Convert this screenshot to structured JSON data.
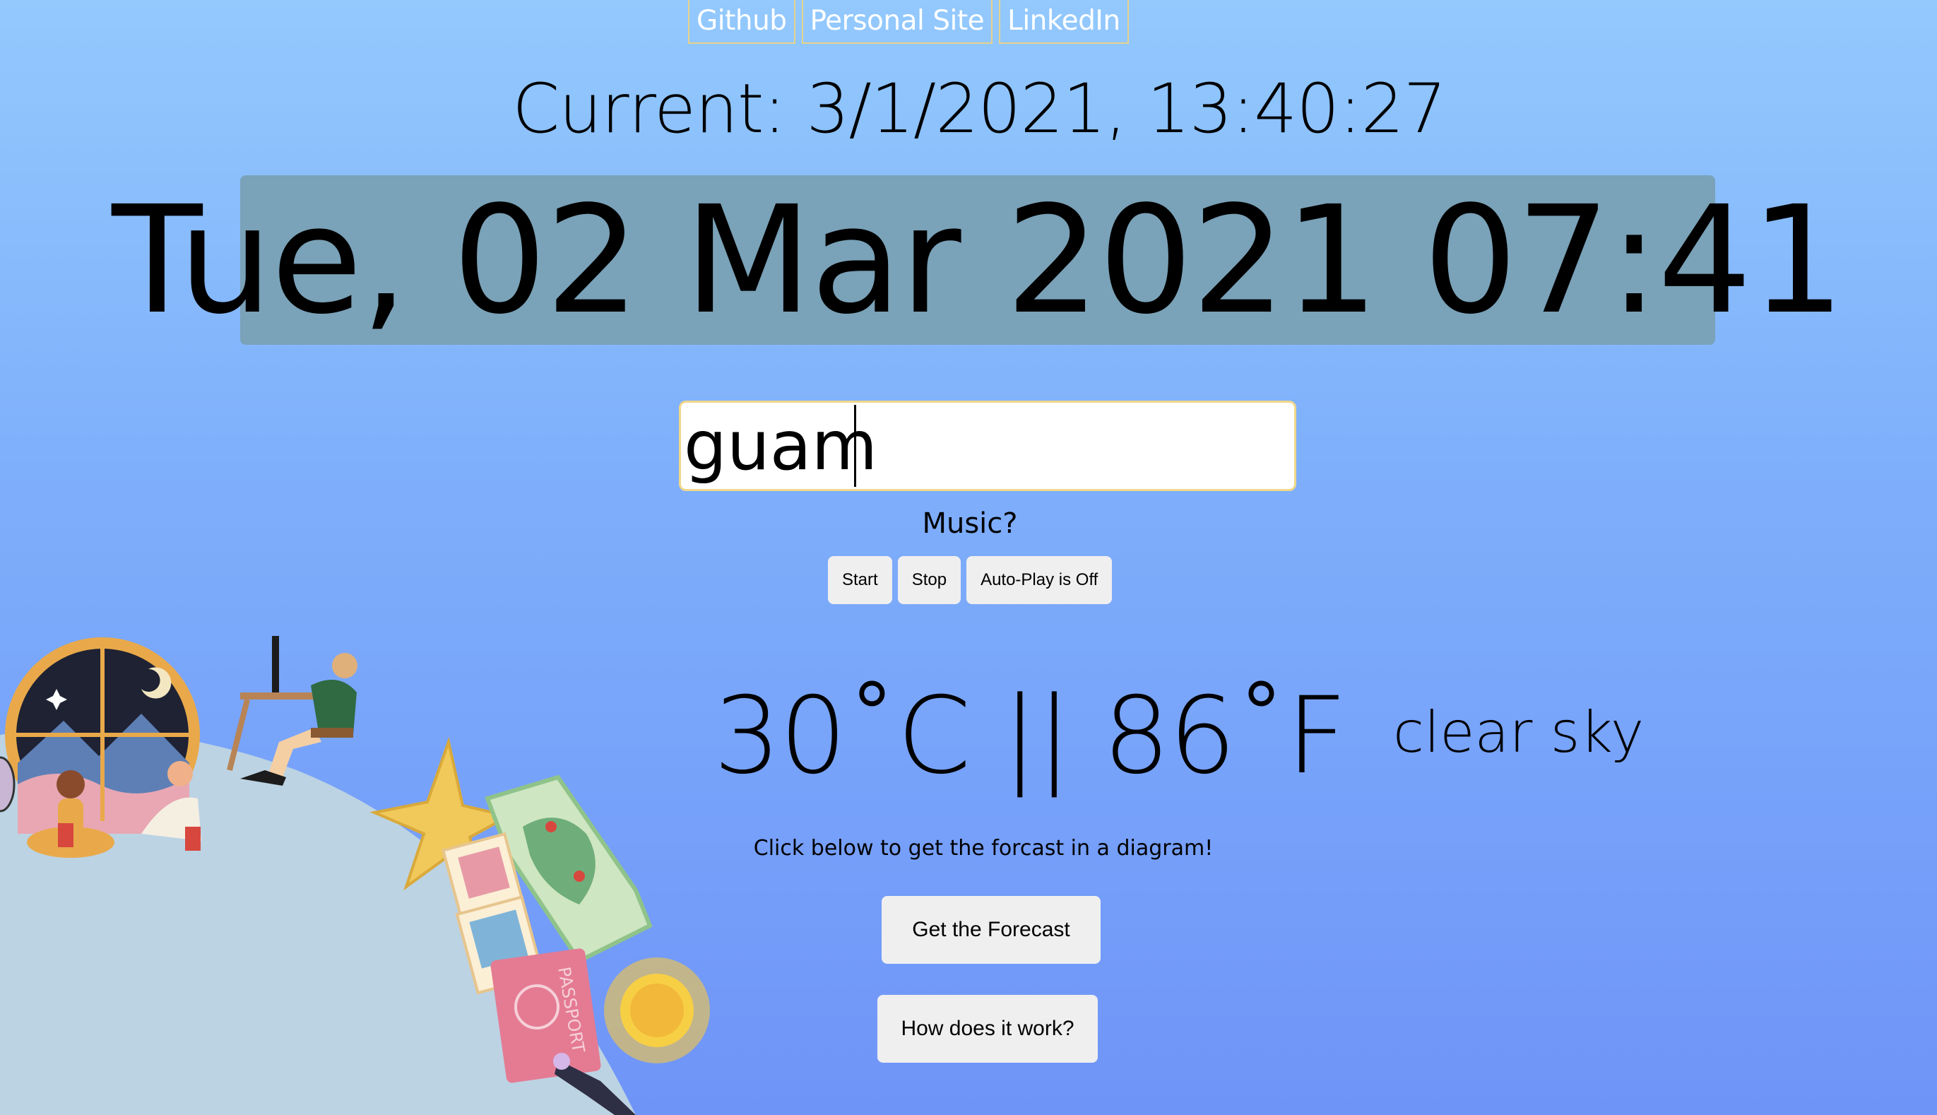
{
  "nav": {
    "links": [
      "Github",
      "Personal Site",
      "LinkedIn"
    ]
  },
  "clock": {
    "current": "Current: 3/1/2021, 13:40:27",
    "destination": "Tue, 02 Mar 2021 07:41"
  },
  "search": {
    "value": "guam"
  },
  "music": {
    "label": "Music?",
    "start": "Start",
    "stop": "Stop",
    "autoplay": "Auto-Play is Off"
  },
  "weather": {
    "temperature": "30˚C || 86˚F",
    "description": "clear sky"
  },
  "forecast": {
    "hint": "Click below to get the forcast in a diagram!",
    "get_button": "Get the Forecast",
    "how_button": "How does it work?"
  },
  "illustration": {
    "passport_text": "PASSPORT"
  },
  "colors": {
    "bg_top": "#93c9fd",
    "bg_bottom": "#6f94f8",
    "clock_bg": "#7aa2b8",
    "nav_border": "#e7d28a",
    "input_border": "#f0d78a"
  }
}
